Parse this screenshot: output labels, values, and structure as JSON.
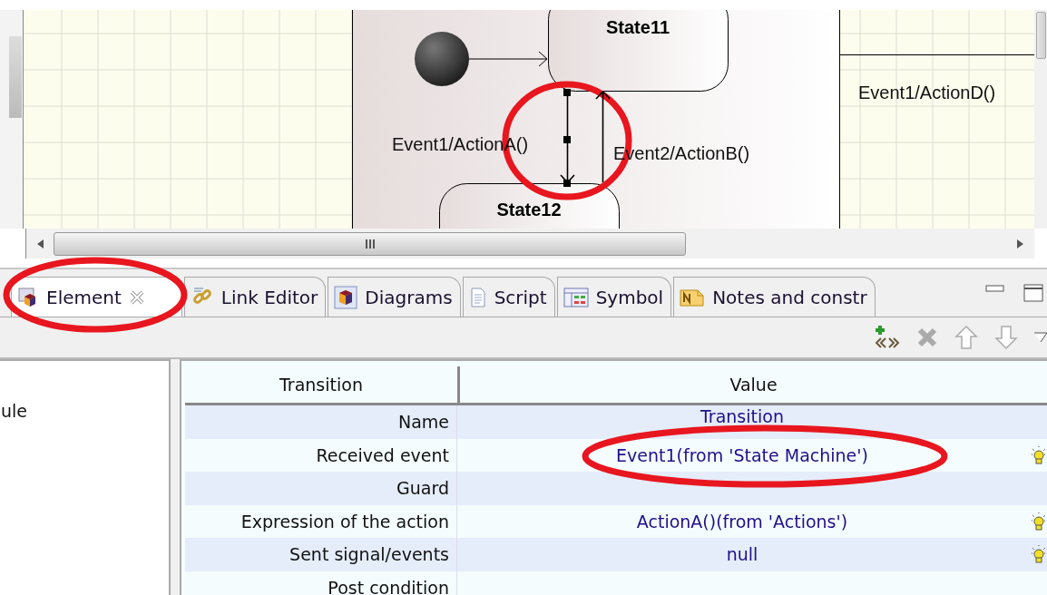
{
  "diagram": {
    "states": [
      {
        "name": "State11"
      },
      {
        "name": "State12"
      }
    ],
    "transitions": [
      {
        "label": "Event1/ActionA()",
        "selected": true
      },
      {
        "label": "Event2/ActionB()",
        "selected": false
      },
      {
        "label": "Event1/ActionD()",
        "selected": false
      }
    ]
  },
  "tabs": [
    {
      "label": "Element",
      "selected": true,
      "closable": true
    },
    {
      "label": "Link Editor",
      "selected": false,
      "closable": false
    },
    {
      "label": "Diagrams",
      "selected": false,
      "closable": false
    },
    {
      "label": "Script",
      "selected": false,
      "closable": false
    },
    {
      "label": "Symbol",
      "selected": false,
      "closable": false
    },
    {
      "label": "Notes and constr",
      "selected": false,
      "closable": false
    }
  ],
  "toolbar": [
    {
      "kind": "add-stereotype",
      "disabled": false
    },
    {
      "kind": "delete",
      "disabled": true
    },
    {
      "kind": "up",
      "disabled": true
    },
    {
      "kind": "down",
      "disabled": true
    }
  ],
  "left_panel": {
    "text": "ule"
  },
  "properties": {
    "columns": [
      "Transition",
      "Value"
    ],
    "rows": [
      {
        "property": "Name",
        "value": "Transition",
        "hint": false
      },
      {
        "property": "Received event",
        "value": "Event1(from 'State Machine')",
        "hint": true
      },
      {
        "property": "Guard",
        "hint": false
      },
      {
        "property": "Expression of the action",
        "value": "ActionA()(from 'Actions')",
        "hint": true
      },
      {
        "property": "Sent signal/events",
        "value": "null",
        "hint": true
      },
      {
        "property": "Post condition",
        "hint": false
      }
    ]
  },
  "highlights": [
    {
      "kind": "ellipse"
    },
    {
      "kind": "ellipse"
    },
    {
      "kind": "ellipse"
    }
  ]
}
